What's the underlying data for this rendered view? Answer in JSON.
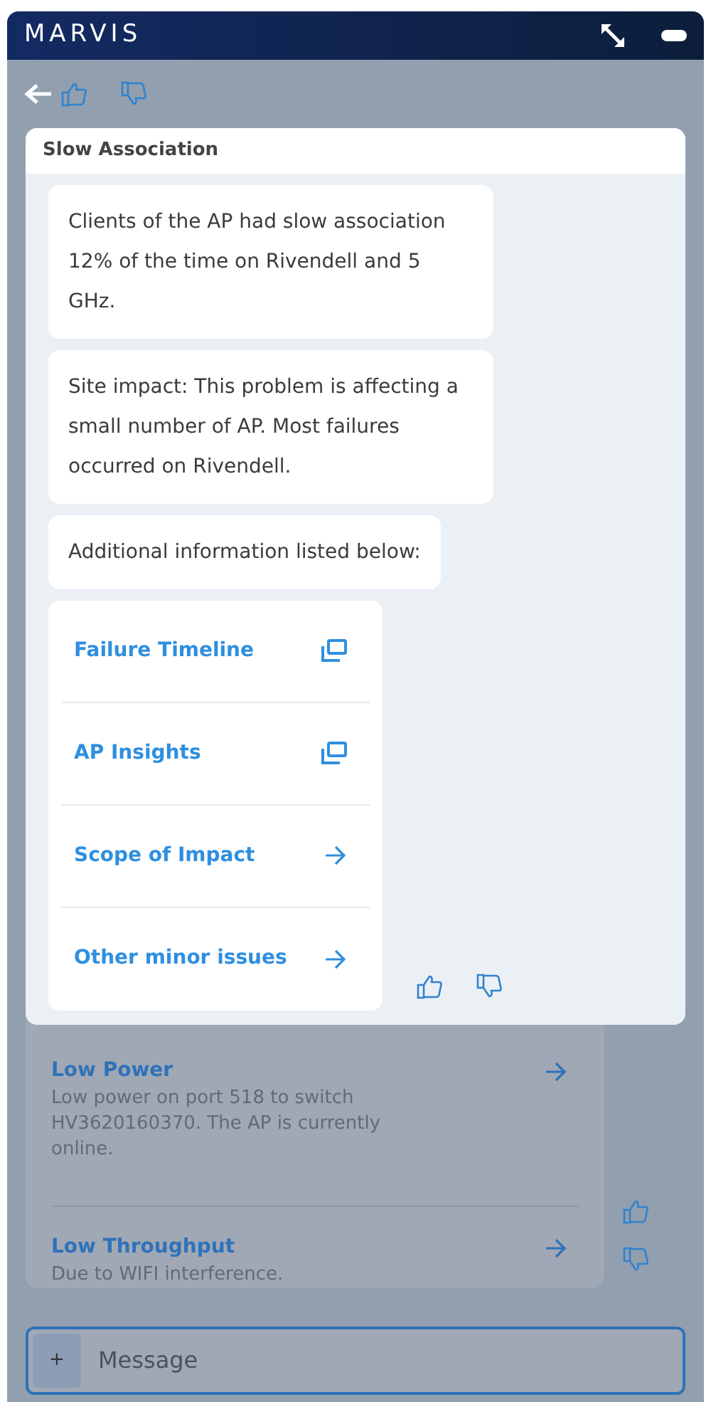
{
  "window": {
    "title": "MARVIS"
  },
  "popup": {
    "title": "Slow Association",
    "messages": [
      "Clients of the AP had slow association 12% of the time on Rivendell and 5 GHz.",
      "Site impact: This problem is affecting a small number of AP. Most failures occurred on Rivendell.",
      "Additional information listed below:"
    ],
    "links": [
      {
        "label": "Failure Timeline",
        "kind": "popout"
      },
      {
        "label": "AP Insights",
        "kind": "popout"
      },
      {
        "label": "Scope of Impact",
        "kind": "arrow"
      },
      {
        "label": "Other minor issues",
        "kind": "arrow"
      }
    ]
  },
  "issues": [
    {
      "title": "Low Power",
      "description": "Low power on port 518 to switch HV3620160370. The AP is currently online."
    },
    {
      "title": "Low Throughput",
      "description": "Due to WIFI interference."
    }
  ],
  "composer": {
    "button": "+",
    "placeholder": "Message"
  }
}
